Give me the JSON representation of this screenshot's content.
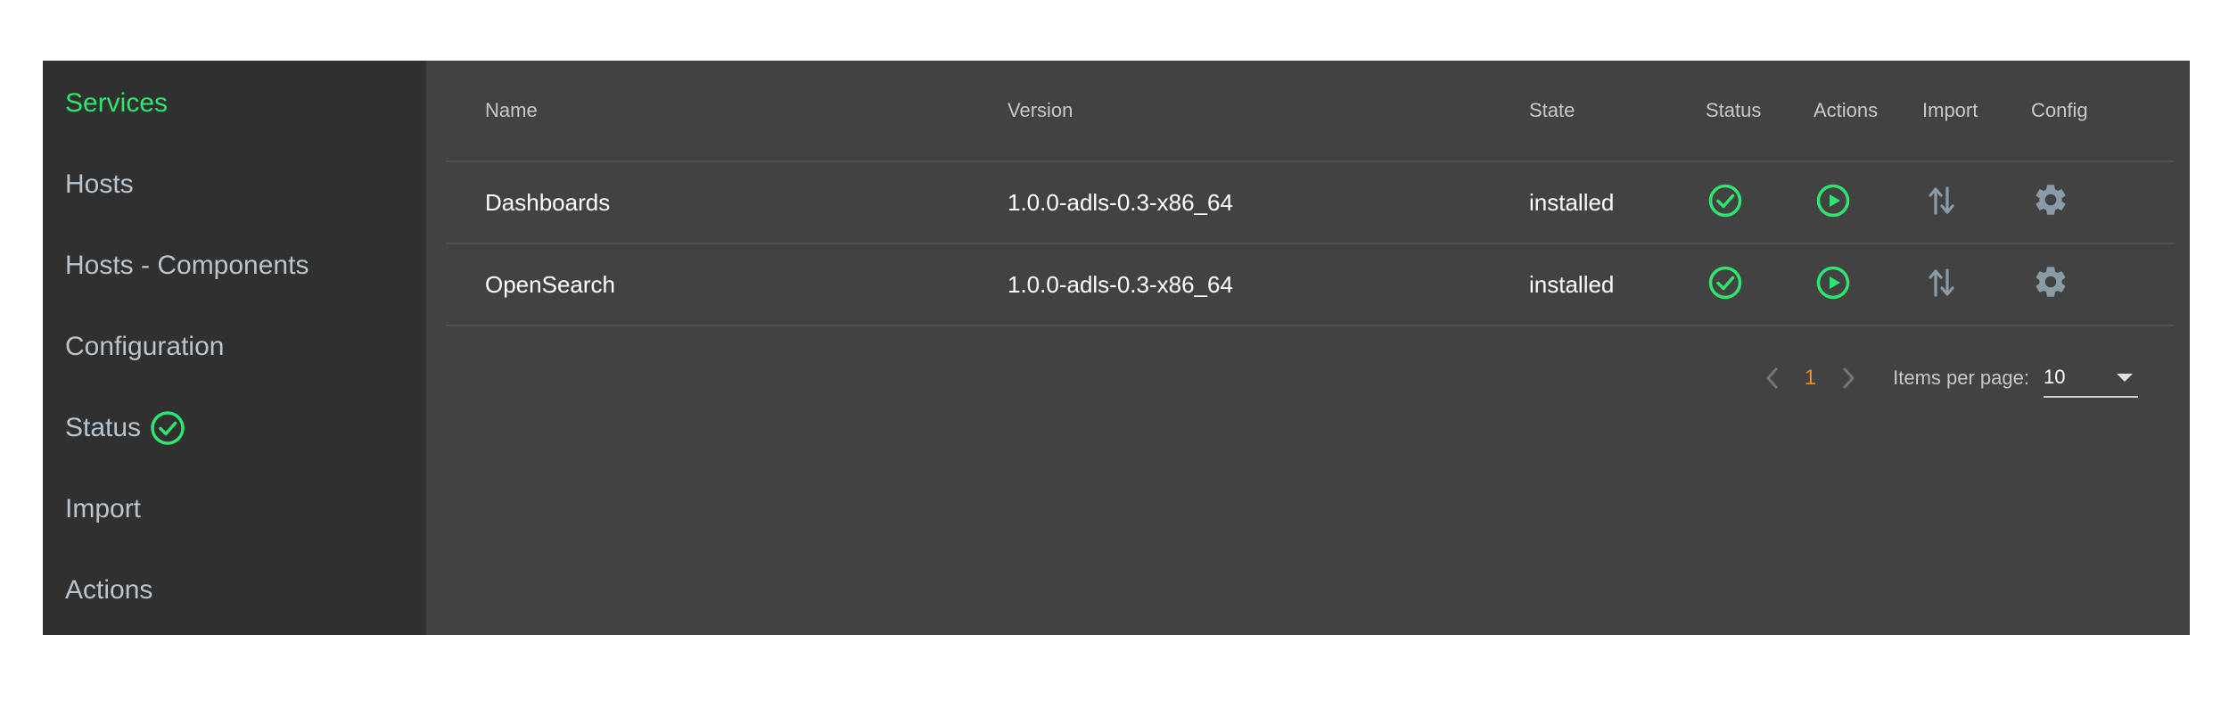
{
  "sidebar": {
    "items": [
      {
        "label": "Services",
        "active": true
      },
      {
        "label": "Hosts"
      },
      {
        "label": "Hosts - Components"
      },
      {
        "label": "Configuration"
      },
      {
        "label": "Status",
        "icon": "check-circle-icon"
      },
      {
        "label": "Import"
      },
      {
        "label": "Actions"
      }
    ]
  },
  "table": {
    "columns": [
      "Name",
      "Version",
      "State",
      "Status",
      "Actions",
      "Import",
      "Config"
    ],
    "rows": [
      {
        "name": "Dashboards",
        "version": "1.0.0-adls-0.3-x86_64",
        "state": "installed"
      },
      {
        "name": "OpenSearch",
        "version": "1.0.0-adls-0.3-x86_64",
        "state": "installed"
      }
    ]
  },
  "pager": {
    "page": "1",
    "items_per_page_label": "Items per page:",
    "items_per_page_value": "10"
  },
  "colors": {
    "accent_green": "#2ee66d",
    "page_number": "#f08a24",
    "icon_gray": "#8a9ba8"
  }
}
